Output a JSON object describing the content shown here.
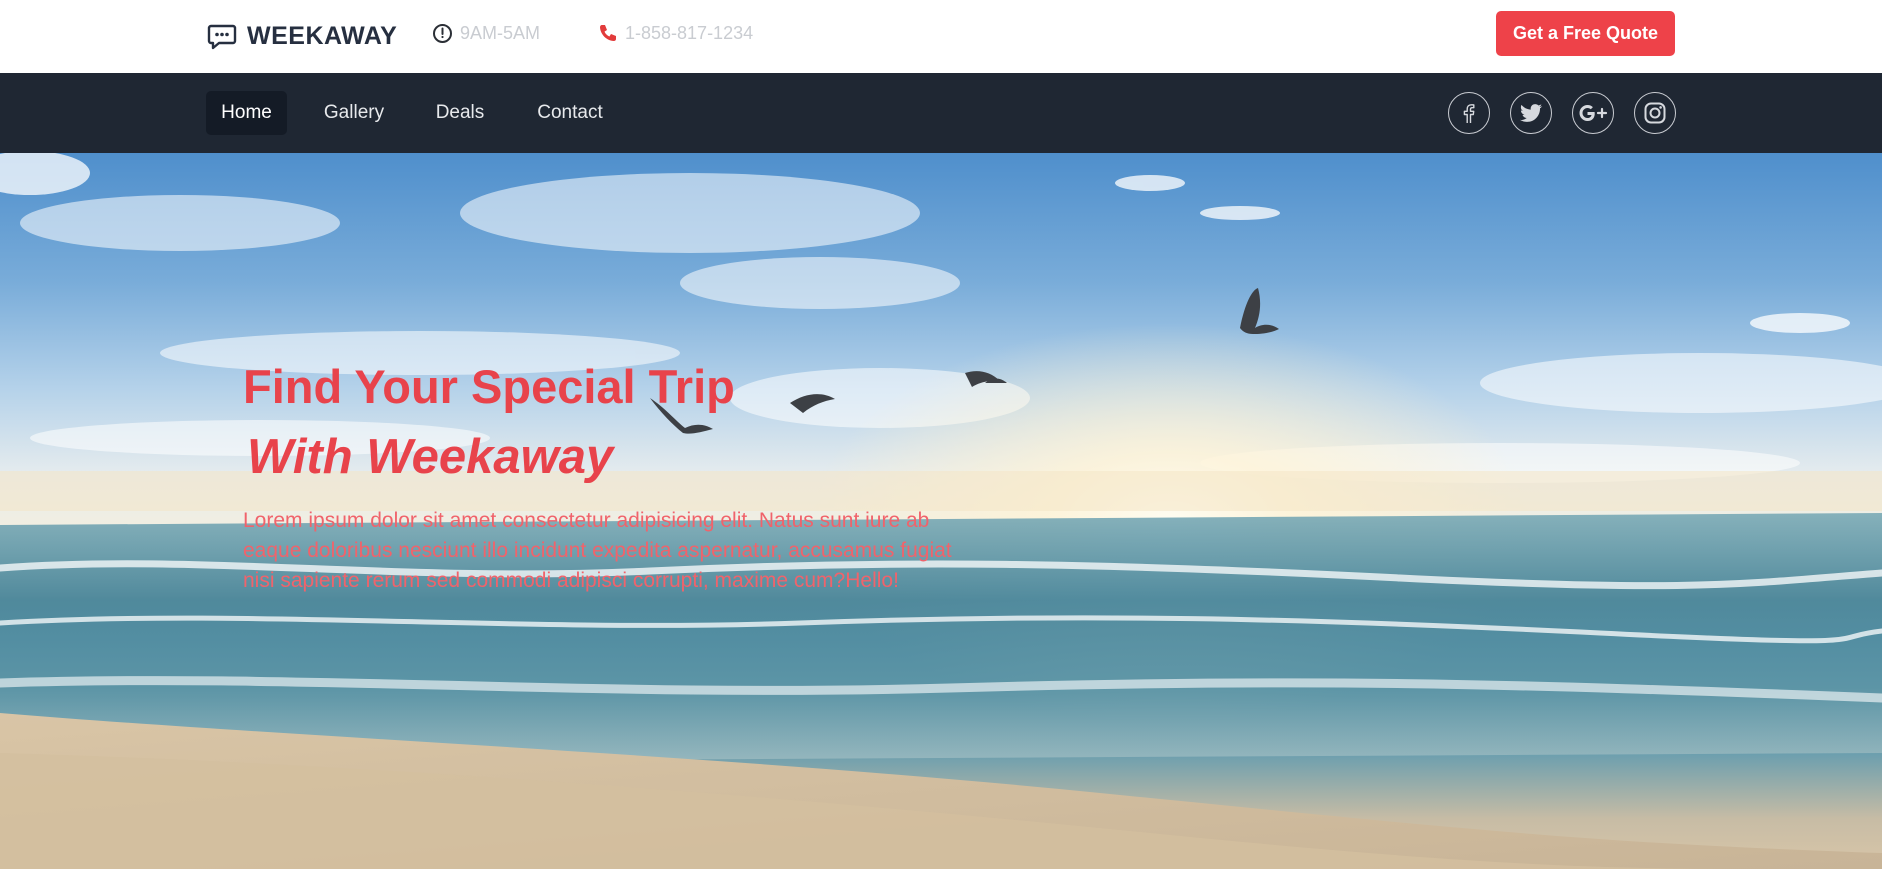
{
  "brand": {
    "name": "WEEKAWAY",
    "icon": "chat-bubble-icon"
  },
  "header": {
    "hours": {
      "icon": "clock-icon",
      "text": "9AM-5AM"
    },
    "phone": {
      "icon": "phone-icon",
      "text": "1-858-817-1234"
    },
    "cta_label": "Get a Free Quote"
  },
  "nav": {
    "items": [
      {
        "label": "Home",
        "active": true
      },
      {
        "label": "Gallery",
        "active": false
      },
      {
        "label": "Deals",
        "active": false
      },
      {
        "label": "Contact",
        "active": false
      }
    ],
    "social": [
      "facebook-icon",
      "twitter-icon",
      "google-plus-icon",
      "instagram-icon"
    ]
  },
  "hero": {
    "title": "Find Your Special Trip",
    "subtitle": "With Weekaway",
    "text": "Lorem ipsum dolor sit amet consectetur adipisicing elit. Natus sunt iure ab eaque doloribus nesciunt illo incidunt expedita aspernatur, accusamus fugiat nisi sapiente rerum sed commodi adipisci corrupti, maxime cum?Hello!"
  },
  "colors": {
    "accent": "#ee4249",
    "nav_bg": "#1f2733",
    "brand_text": "#262f40",
    "muted_text": "#c9ccd1"
  }
}
